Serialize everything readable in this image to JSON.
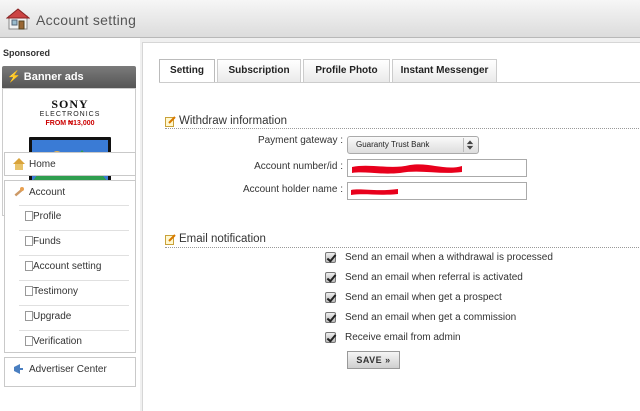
{
  "window": {
    "title": "Account setting"
  },
  "sidebar": {
    "sponsored_label": "Sponsored",
    "banner_header": "Banner ads",
    "ad": {
      "brand": "SONY",
      "brand_sub": "ELECTRONICS",
      "price": "FROM ₦13,000"
    },
    "nav": {
      "home": "Home",
      "account": "Account",
      "items": [
        "Profile",
        "Funds",
        "Account setting",
        "Testimony",
        "Upgrade",
        "Verification"
      ],
      "advertiser": "Advertiser Center"
    }
  },
  "tabs": [
    "Setting",
    "Subscription",
    "Profile Photo",
    "Instant Messenger"
  ],
  "active_tab": "Setting",
  "withdraw": {
    "title": "Withdraw information",
    "payment_label": "Payment gateway :",
    "payment_value": "Guaranty Trust Bank",
    "account_number_label": "Account number/id :",
    "account_holder_label": "Account holder name :"
  },
  "email": {
    "title": "Email notification",
    "options": [
      {
        "label": "Send an email when a withdrawal is processed",
        "checked": true
      },
      {
        "label": "Send an email when referral is activated",
        "checked": true
      },
      {
        "label": "Send an email when get a prospect",
        "checked": true
      },
      {
        "label": "Send an email when get a commission",
        "checked": true
      },
      {
        "label": "Receive email from admin",
        "checked": true
      }
    ]
  },
  "save_label": "SAVE »",
  "colors": {
    "redaction": "#e8001c",
    "banner_header": "#666666"
  }
}
